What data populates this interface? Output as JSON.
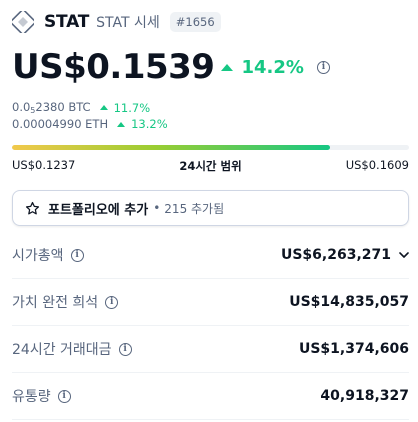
{
  "header": {
    "name": "STAT",
    "symbol": "STAT 시세",
    "rank": "#1656",
    "logo_icon": "stat-logo-icon"
  },
  "price": {
    "value": "US$0.1539",
    "change": "14.2%",
    "change_color": "#16c784",
    "info_icon": "info-icon"
  },
  "conversions": [
    {
      "prefix": "0.0",
      "sub": "5",
      "rest": "2380 BTC",
      "change": "11.7%"
    },
    {
      "prefix": "0.00004990 ETH",
      "sub": "",
      "rest": "",
      "change": "13.2%"
    }
  ],
  "range": {
    "low": "US$0.1237",
    "label": "24시간 범위",
    "high": "US$0.1609",
    "fill_fraction": 0.8
  },
  "portfolio": {
    "label": "포트폴리오에 추가",
    "separator": "•",
    "count": "215 추가됨",
    "icon": "star-icon"
  },
  "stats": [
    {
      "label": "시가총액",
      "value": "US$6,263,271",
      "has_chevron": true
    },
    {
      "label": "가치 완전 희석",
      "value": "US$14,835,057",
      "has_chevron": false
    },
    {
      "label": "24시간 거래대금",
      "value": "US$1,374,606",
      "has_chevron": false
    },
    {
      "label": "유통량",
      "value": "40,918,327",
      "has_chevron": false
    }
  ],
  "colors": {
    "accent_green": "#16c784",
    "text_primary": "#0d1421",
    "text_secondary": "#58667e",
    "divider": "#eff2f5"
  }
}
